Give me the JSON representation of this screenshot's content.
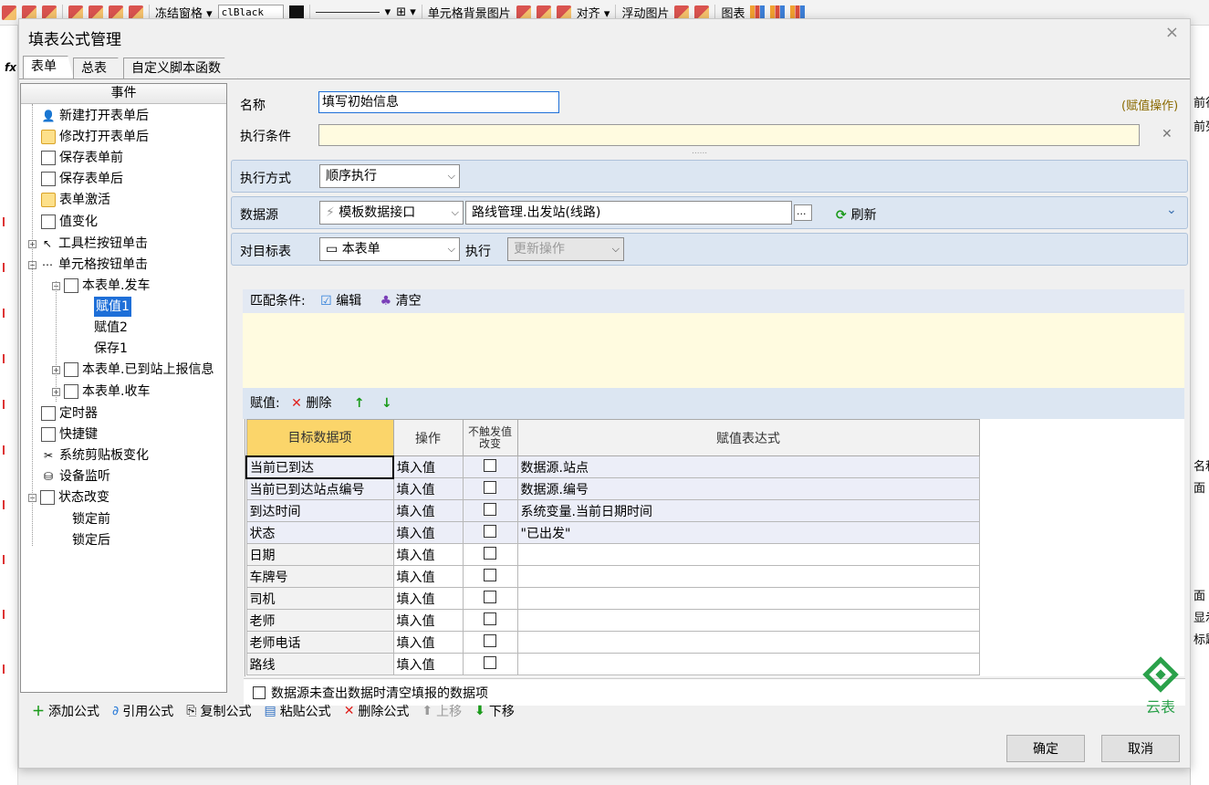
{
  "app_toolbar": {
    "freeze": "冻结窗格 ▾",
    "color_combo": "clBlack",
    "cell_bg": "单元格背景图片",
    "align": "对齐 ▾",
    "float_img": "浮动图片",
    "chart": "图表"
  },
  "app_right": {
    "r1": "前行",
    "r2": "前列",
    "r3": "名和",
    "r4": "面",
    "r5": "面",
    "r6": "显示",
    "r7": "标题"
  },
  "dialog": {
    "title": "填表公式管理",
    "close": "×"
  },
  "tabs": [
    "表单",
    "总表",
    "自定义脚本函数"
  ],
  "tree": {
    "header": "事件",
    "nodes": [
      {
        "label": "新建打开表单后",
        "icon": "user-plus-icon"
      },
      {
        "label": "修改打开表单后",
        "icon": "folder-icon"
      },
      {
        "label": "保存表单前",
        "icon": "save-icon"
      },
      {
        "label": "保存表单后",
        "icon": "save-icon"
      },
      {
        "label": "表单激活",
        "icon": "folder-icon"
      },
      {
        "label": "值变化",
        "icon": "edit-doc-icon"
      },
      {
        "label": "工具栏按钮单击",
        "icon": "pointer-icon"
      },
      {
        "label": "单元格按钮单击",
        "icon": "ellipsis-icon"
      },
      {
        "label": "本表单.发车",
        "icon": "table-icon"
      },
      {
        "label": "赋值1",
        "icon": ""
      },
      {
        "label": "赋值2",
        "icon": ""
      },
      {
        "label": "保存1",
        "icon": ""
      },
      {
        "label": "本表单.已到站上报信息",
        "icon": "table-icon"
      },
      {
        "label": "本表单.收车",
        "icon": "table-icon"
      },
      {
        "label": "定时器",
        "icon": "timer-icon"
      },
      {
        "label": "快捷键",
        "icon": "shortcut-icon"
      },
      {
        "label": "系统剪贴板变化",
        "icon": "scissors-icon"
      },
      {
        "label": "设备监听",
        "icon": "device-icon"
      },
      {
        "label": "状态改变",
        "icon": "state-icon"
      },
      {
        "label": "锁定前",
        "icon": ""
      },
      {
        "label": "锁定后",
        "icon": ""
      }
    ]
  },
  "form": {
    "name_label": "名称",
    "name_value": "填写初始信息",
    "op_type": "(赋值操作)",
    "cond_label": "执行条件",
    "cond_value": "",
    "exec_mode_label": "执行方式",
    "exec_mode_value": "顺序执行",
    "datasource_label": "数据源",
    "datasource_type": "模板数据接口",
    "datasource_value": "路线管理.出发站(线路)",
    "browse": "...",
    "refresh": "刷新",
    "target_label": "对目标表",
    "target_value": "本表单",
    "exec_label": "执行",
    "exec_value": "更新操作"
  },
  "match": {
    "label": "匹配条件:",
    "edit": "编辑",
    "clear": "清空"
  },
  "assign": {
    "label": "赋值:",
    "delete": "删除",
    "up": "↑",
    "down": "↓"
  },
  "grid": {
    "headers": [
      "目标数据项",
      "操作",
      "不触发值改变",
      "赋值表达式"
    ],
    "rows": [
      {
        "target": "当前已到达",
        "op": "填入值",
        "expr": "数据源.站点"
      },
      {
        "target": "当前已到达站点编号",
        "op": "填入值",
        "expr": "数据源.编号"
      },
      {
        "target": "到达时间",
        "op": "填入值",
        "expr": "系统变量.当前日期时间"
      },
      {
        "target": "状态",
        "op": "填入值",
        "expr": "\"已出发\""
      },
      {
        "target": "日期",
        "op": "填入值",
        "expr": ""
      },
      {
        "target": "车牌号",
        "op": "填入值",
        "expr": ""
      },
      {
        "target": "司机",
        "op": "填入值",
        "expr": ""
      },
      {
        "target": "老师",
        "op": "填入值",
        "expr": ""
      },
      {
        "target": "老师电话",
        "op": "填入值",
        "expr": ""
      },
      {
        "target": "路线",
        "op": "填入值",
        "expr": ""
      }
    ]
  },
  "clear_option": "数据源未查出数据时清空填报的数据项",
  "bottom": {
    "add": "添加公式",
    "ref": "引用公式",
    "copy": "复制公式",
    "paste": "粘贴公式",
    "del": "删除公式",
    "up": "上移",
    "down": "下移"
  },
  "logo_text": "云表",
  "ok": "确定",
  "cancel": "取消"
}
